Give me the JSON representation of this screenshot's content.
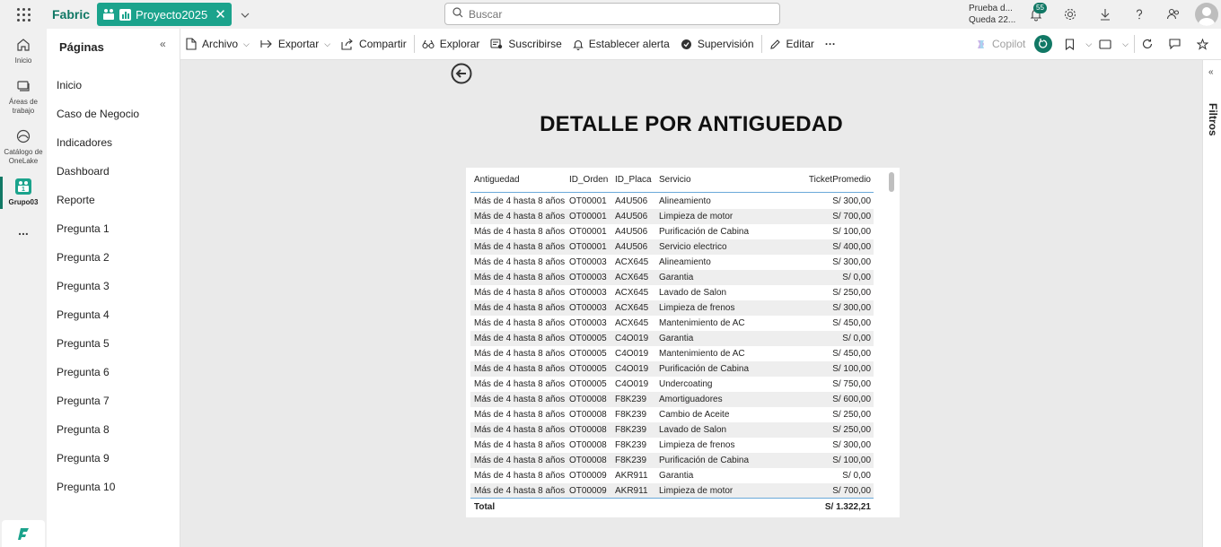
{
  "topbar": {
    "brand": "Fabric",
    "workspace_tab": "Proyecto2025",
    "search_placeholder": "Buscar",
    "trial_line1": "Prueba d...",
    "trial_line2": "Queda 22...",
    "notification_count": "55"
  },
  "rail": {
    "items": [
      {
        "label": "Inicio",
        "icon": "home-icon"
      },
      {
        "label": "Áreas de trabajo",
        "icon": "workspaces-icon"
      },
      {
        "label": "Catálogo de OneLake",
        "icon": "onelake-icon"
      },
      {
        "label": "Grupo03",
        "icon": "workspace-group-icon"
      }
    ],
    "more": "..."
  },
  "pages": {
    "title": "Páginas",
    "items": [
      "Inicio",
      "Caso de Negocio",
      "Indicadores",
      "Dashboard",
      "Reporte",
      "Pregunta 1",
      "Pregunta 2",
      "Pregunta 3",
      "Pregunta 4",
      "Pregunta 5",
      "Pregunta 6",
      "Pregunta 7",
      "Pregunta 8",
      "Pregunta 9",
      "Pregunta 10"
    ]
  },
  "commands": {
    "archivo": "Archivo",
    "exportar": "Exportar",
    "compartir": "Compartir",
    "explorar": "Explorar",
    "suscribirse": "Suscribirse",
    "alerta": "Establecer alerta",
    "supervision": "Supervisión",
    "editar": "Editar",
    "more": "···",
    "copilot": "Copilot"
  },
  "report": {
    "title": "DETALLE POR ANTIGUEDAD",
    "columns": [
      "Antiguedad",
      "ID_Orden",
      "ID_Placa",
      "Servicio",
      "TicketPromedio"
    ],
    "rows": [
      [
        "Más de 4 hasta 8 años",
        "OT00001",
        "A4U506",
        "Alineamiento",
        "S/ 300,00"
      ],
      [
        "Más de 4 hasta 8 años",
        "OT00001",
        "A4U506",
        "Limpieza de motor",
        "S/ 700,00"
      ],
      [
        "Más de 4 hasta 8 años",
        "OT00001",
        "A4U506",
        "Purificación de Cabina",
        "S/ 100,00"
      ],
      [
        "Más de 4 hasta 8 años",
        "OT00001",
        "A4U506",
        "Servicio electrico",
        "S/ 400,00"
      ],
      [
        "Más de 4 hasta 8 años",
        "OT00003",
        "ACX645",
        "Alineamiento",
        "S/ 300,00"
      ],
      [
        "Más de 4 hasta 8 años",
        "OT00003",
        "ACX645",
        "Garantia",
        "S/ 0,00"
      ],
      [
        "Más de 4 hasta 8 años",
        "OT00003",
        "ACX645",
        "Lavado de Salon",
        "S/ 250,00"
      ],
      [
        "Más de 4 hasta 8 años",
        "OT00003",
        "ACX645",
        "Limpieza de frenos",
        "S/ 300,00"
      ],
      [
        "Más de 4 hasta 8 años",
        "OT00003",
        "ACX645",
        "Mantenimiento de AC",
        "S/ 450,00"
      ],
      [
        "Más de 4 hasta 8 años",
        "OT00005",
        "C4O019",
        "Garantia",
        "S/ 0,00"
      ],
      [
        "Más de 4 hasta 8 años",
        "OT00005",
        "C4O019",
        "Mantenimiento de AC",
        "S/ 450,00"
      ],
      [
        "Más de 4 hasta 8 años",
        "OT00005",
        "C4O019",
        "Purificación de Cabina",
        "S/ 100,00"
      ],
      [
        "Más de 4 hasta 8 años",
        "OT00005",
        "C4O019",
        "Undercoating",
        "S/ 750,00"
      ],
      [
        "Más de 4 hasta 8 años",
        "OT00008",
        "F8K239",
        "Amortiguadores",
        "S/ 600,00"
      ],
      [
        "Más de 4 hasta 8 años",
        "OT00008",
        "F8K239",
        "Cambio de Aceite",
        "S/ 250,00"
      ],
      [
        "Más de 4 hasta 8 años",
        "OT00008",
        "F8K239",
        "Lavado de Salon",
        "S/ 250,00"
      ],
      [
        "Más de 4 hasta 8 años",
        "OT00008",
        "F8K239",
        "Limpieza de frenos",
        "S/ 300,00"
      ],
      [
        "Más de 4 hasta 8 años",
        "OT00008",
        "F8K239",
        "Purificación de Cabina",
        "S/ 100,00"
      ],
      [
        "Más de 4 hasta 8 años",
        "OT00009",
        "AKR911",
        "Garantia",
        "S/ 0,00"
      ],
      [
        "Más de 4 hasta 8 años",
        "OT00009",
        "AKR911",
        "Limpieza de motor",
        "S/ 700,00"
      ]
    ],
    "total_label": "Total",
    "total_value": "S/ 1.322,21"
  },
  "filters": {
    "label": "Filtros"
  },
  "colors": {
    "brand": "#117865",
    "workspace_tab": "#1ba38c",
    "table_header_line": "#6aa9d9"
  }
}
